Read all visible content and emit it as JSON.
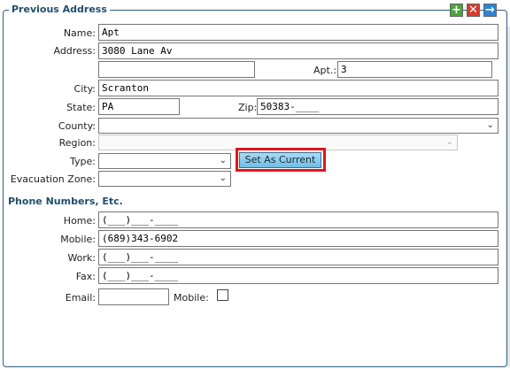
{
  "section_title": "Previous Address",
  "toolbar": {
    "add_icon": "+",
    "delete_icon": "✕",
    "next_icon": "→"
  },
  "address": {
    "name_label": "Name:",
    "name_value": "Apt",
    "address_label": "Address:",
    "address_value": "3080 Lane Av",
    "address2_value": "",
    "apt_label": "Apt.:",
    "apt_value": "3",
    "city_label": "City:",
    "city_value": "Scranton",
    "state_label": "State:",
    "state_value": "PA",
    "zip_label": "Zip:",
    "zip_value": "50383-____",
    "county_label": "County:",
    "county_value": "",
    "region_label": "Region:",
    "region_value": "",
    "type_label": "Type:",
    "type_value": "",
    "set_current_label": "Set As Current",
    "evac_label": "Evacuation Zone:",
    "evac_value": ""
  },
  "phones": {
    "heading": "Phone Numbers, Etc.",
    "home_label": "Home:",
    "home_value": "(___)___-____",
    "mobile_label": "Mobile:",
    "mobile_value": "(689)343-6902",
    "work_label": "Work:",
    "work_value": "(___)___-____",
    "fax_label": "Fax:",
    "fax_value": "(___)___-____",
    "email_label": "Email:",
    "email_value": "",
    "email_mobile_label": "Mobile:"
  }
}
